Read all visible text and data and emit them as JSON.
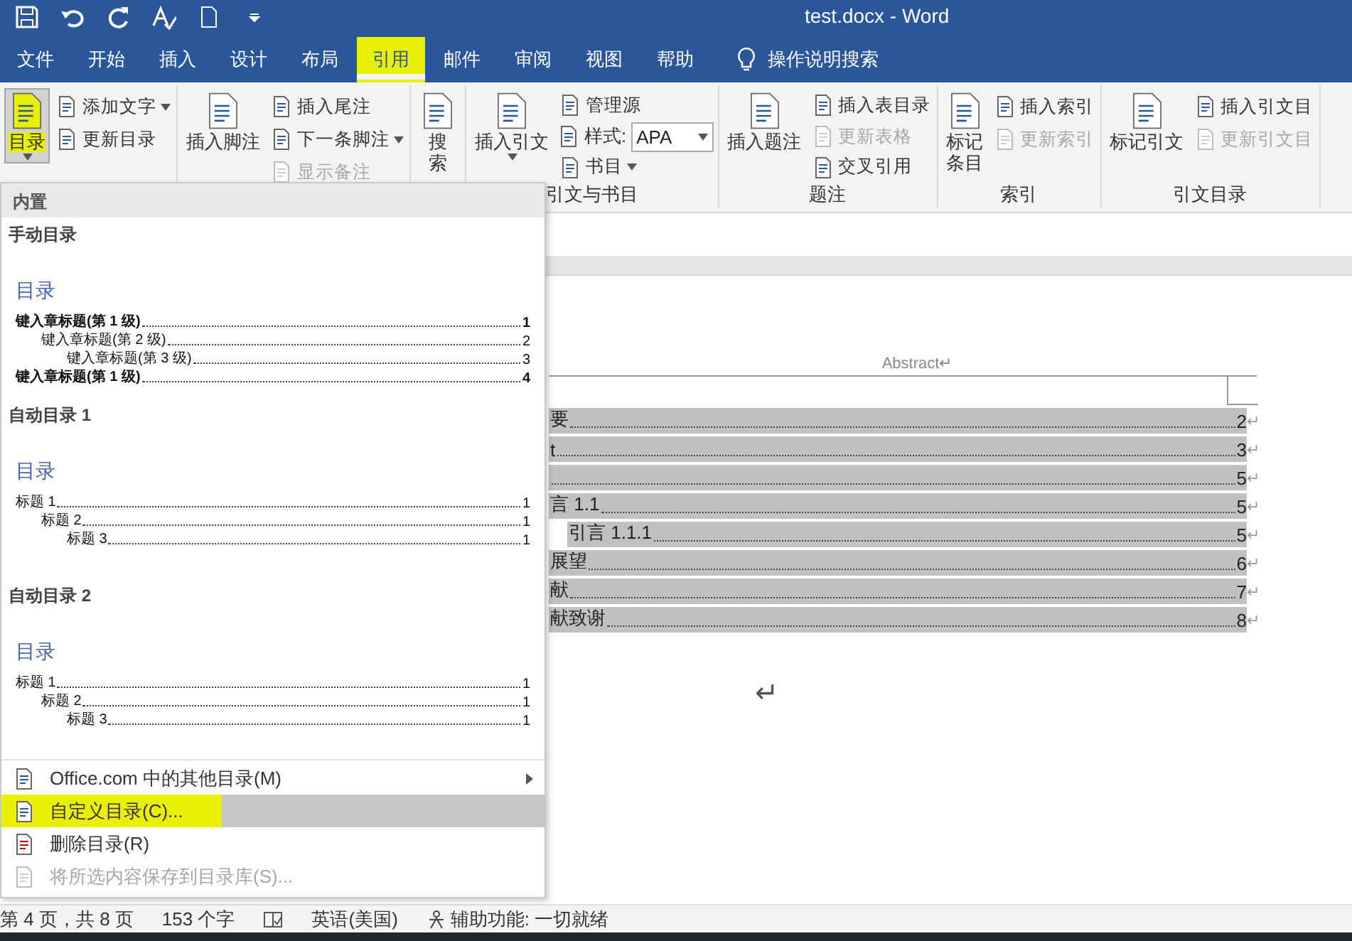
{
  "window": {
    "title": "test.docx - Word"
  },
  "tabs": [
    {
      "label": "文件",
      "selected": false,
      "highlighted": false
    },
    {
      "label": "开始",
      "selected": false,
      "highlighted": false
    },
    {
      "label": "插入",
      "selected": false,
      "highlighted": false
    },
    {
      "label": "设计",
      "selected": false,
      "highlighted": false
    },
    {
      "label": "布局",
      "selected": false,
      "highlighted": false
    },
    {
      "label": "引用",
      "selected": true,
      "highlighted": true
    },
    {
      "label": "邮件",
      "selected": false,
      "highlighted": false
    },
    {
      "label": "审阅",
      "selected": false,
      "highlighted": false
    },
    {
      "label": "视图",
      "selected": false,
      "highlighted": false
    },
    {
      "label": "帮助",
      "selected": false,
      "highlighted": false
    }
  ],
  "tell_me": {
    "placeholder": "操作说明搜索"
  },
  "ribbon": {
    "groups": [
      {
        "items": [
          {
            "kind": "large",
            "lines": [
              "目录"
            ],
            "caret": true,
            "disabled": false,
            "pressed": true,
            "highlighted": true
          },
          {
            "kind": "small",
            "label": "添加文字",
            "caret": true,
            "disabled": false
          },
          {
            "kind": "small",
            "label": "更新目录",
            "caret": false,
            "disabled": false
          }
        ]
      },
      {
        "items": [
          {
            "kind": "large",
            "lines": [
              "插入脚注"
            ],
            "caret": false,
            "disabled": false,
            "pressed": false,
            "highlighted": false
          },
          {
            "kind": "small",
            "label": "插入尾注",
            "caret": false,
            "disabled": false
          },
          {
            "kind": "small",
            "label": "下一条脚注",
            "caret": true,
            "disabled": false
          },
          {
            "kind": "small",
            "label": "显示备注",
            "caret": false,
            "disabled": true
          }
        ]
      },
      {
        "items": [
          {
            "kind": "large",
            "lines": [
              "搜",
              "索"
            ],
            "caret": false,
            "disabled": false,
            "pressed": false,
            "highlighted": false
          }
        ]
      },
      {
        "label": "引文与书目",
        "items": [
          {
            "kind": "large",
            "lines": [
              "插入引文"
            ],
            "caret": true,
            "disabled": false,
            "pressed": false,
            "highlighted": false
          },
          {
            "kind": "small",
            "label": "管理源",
            "caret": false,
            "disabled": false
          },
          {
            "kind": "select",
            "label": "样式:",
            "value": "APA",
            "caret": true,
            "disabled": false
          },
          {
            "kind": "small",
            "label": "书目",
            "caret": true,
            "disabled": false
          }
        ]
      },
      {
        "label": "题注",
        "items": [
          {
            "kind": "large",
            "lines": [
              "插入题注"
            ],
            "caret": false,
            "disabled": false,
            "pressed": false,
            "highlighted": false
          },
          {
            "kind": "small",
            "label": "插入表目录",
            "caret": false,
            "disabled": false
          },
          {
            "kind": "small",
            "label": "更新表格",
            "caret": false,
            "disabled": true
          },
          {
            "kind": "small",
            "label": "交叉引用",
            "caret": false,
            "disabled": false
          }
        ]
      },
      {
        "label": "索引",
        "items": [
          {
            "kind": "large",
            "lines": [
              "标记",
              "条目"
            ],
            "caret": false,
            "disabled": false,
            "pressed": false,
            "highlighted": false
          },
          {
            "kind": "small",
            "label": "插入索引",
            "caret": false,
            "disabled": false
          },
          {
            "kind": "small",
            "label": "更新索引",
            "caret": false,
            "disabled": true
          }
        ]
      },
      {
        "label": "引文目录",
        "items": [
          {
            "kind": "large",
            "lines": [
              "标记引文"
            ],
            "caret": false,
            "disabled": false,
            "pressed": false,
            "highlighted": false
          },
          {
            "kind": "small",
            "label": "插入引文目",
            "caret": false,
            "disabled": false
          },
          {
            "kind": "small",
            "label": "更新引文目",
            "caret": false,
            "disabled": true
          }
        ]
      }
    ]
  },
  "document": {
    "header": "Abstract↵",
    "toc": [
      {
        "text": "要",
        "page": "2",
        "mark": "↵"
      },
      {
        "text": "t",
        "page": "3",
        "mark": "↵"
      },
      {
        "page": "5",
        "mark": "↵"
      },
      {
        "text": "言 1.1",
        "page": "5",
        "mark": "↵",
        "children": [
          {
            "text": "引言 1.1.1",
            "page": "5",
            "mark": "↵"
          }
        ]
      },
      {
        "text": "展望",
        "page": "6",
        "mark": "↵"
      },
      {
        "text": "献",
        "page": "7",
        "mark": "↵"
      },
      {
        "text": "献致谢",
        "page": "8",
        "mark": "↵"
      }
    ],
    "return_mark": "↵"
  },
  "toc_menu": {
    "header": "内置",
    "gallery": [
      {
        "name": "手动目录",
        "preview": {
          "title": "目录",
          "entries": [
            {
              "text": "键入章标题(第 1 级)",
              "page": "1",
              "bold": true,
              "children": [
                {
                  "text": "键入章标题(第 2 级)",
                  "page": "2",
                  "bold": false,
                  "children": [
                    {
                      "text": "键入章标题(第 3 级)",
                      "page": "3",
                      "bold": false
                    }
                  ]
                }
              ]
            },
            {
              "text": "键入章标题(第 1 级)",
              "page": "4",
              "bold": true
            }
          ]
        }
      },
      {
        "name": "自动目录 1",
        "preview": {
          "title": "目录",
          "entries": [
            {
              "text": "标题 1",
              "page": "1",
              "bold": false,
              "children": [
                {
                  "text": "标题 2",
                  "page": "1",
                  "bold": false,
                  "children": [
                    {
                      "text": "标题 3",
                      "page": "1",
                      "bold": false
                    }
                  ]
                }
              ]
            }
          ]
        }
      },
      {
        "name": "自动目录 2",
        "preview": {
          "title": "目录",
          "entries": [
            {
              "text": "标题 1",
              "page": "1",
              "bold": false,
              "children": [
                {
                  "text": "标题 2",
                  "page": "1",
                  "bold": false,
                  "children": [
                    {
                      "text": "标题 3",
                      "page": "1",
                      "bold": false
                    }
                  ]
                }
              ]
            }
          ]
        }
      }
    ],
    "commands": [
      {
        "label": "Office.com 中的其他目录(M)",
        "submenu": true,
        "selected": false,
        "highlighted": false,
        "disabled": false
      },
      {
        "label": "自定义目录(C)...",
        "submenu": false,
        "selected": true,
        "highlighted": true,
        "disabled": false
      },
      {
        "label": "删除目录(R)",
        "submenu": false,
        "selected": false,
        "highlighted": false,
        "disabled": false
      },
      {
        "label": "将所选内容保存到目录库(S)...",
        "submenu": false,
        "selected": false,
        "highlighted": false,
        "disabled": true
      }
    ]
  },
  "status_bar": {
    "page": "第 4 页，共 8 页",
    "words": "153 个字",
    "language": "英语(美国)",
    "accessibility": "辅助功能: 一切就绪"
  }
}
